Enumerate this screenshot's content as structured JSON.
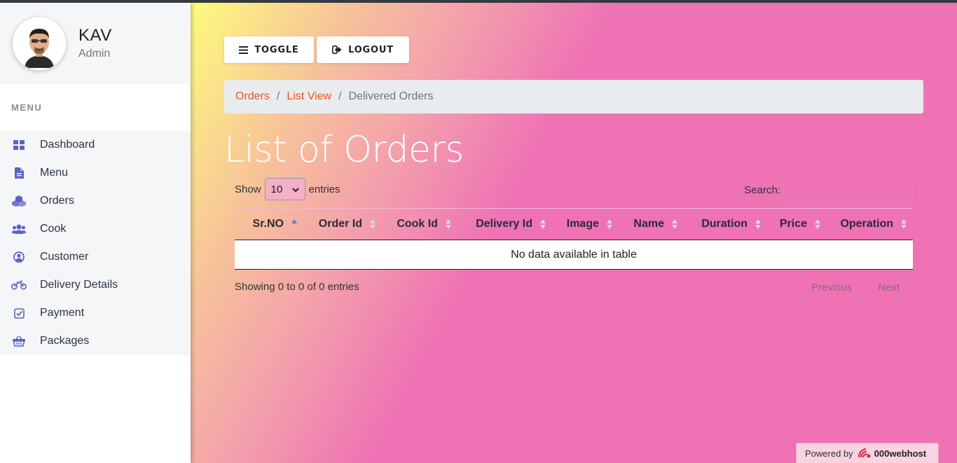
{
  "profile": {
    "name": "KAV",
    "role": "Admin"
  },
  "sidebar": {
    "menu_heading": "MENU",
    "items": [
      {
        "label": "Dashboard",
        "icon": "dashboard-grid-icon"
      },
      {
        "label": "Menu",
        "icon": "document-icon"
      },
      {
        "label": "Orders",
        "icon": "boxes-icon"
      },
      {
        "label": "Cook",
        "icon": "users-icon"
      },
      {
        "label": "Customer",
        "icon": "user-circle-icon"
      },
      {
        "label": "Delivery Details",
        "icon": "motorcycle-icon"
      },
      {
        "label": "Payment",
        "icon": "check-square-icon"
      },
      {
        "label": "Packages",
        "icon": "basket-icon"
      }
    ],
    "icon_color": "#5a63c4"
  },
  "toolbar": {
    "toggle_label": "TOGGLE",
    "logout_label": "LOGOUT"
  },
  "breadcrumb": {
    "items": [
      "Orders",
      "List View"
    ],
    "current": "Delivered Orders",
    "separator": "/"
  },
  "page_title": "List of Orders",
  "table_controls": {
    "show_label": "Show",
    "entries_label": "entries",
    "page_length": "10",
    "search_label": "Search:"
  },
  "table": {
    "columns": [
      "Sr.NO",
      "Order Id",
      "Cook Id",
      "Delivery Id",
      "Image",
      "Name",
      "Duration",
      "Price",
      "Operation"
    ],
    "empty_message": "No data available in table"
  },
  "pagination": {
    "info": "Showing 0 to 0 of 0 entries",
    "previous": "Previous",
    "next": "Next"
  },
  "footer": {
    "powered_by": "Powered by",
    "brand": "000webhost"
  },
  "colors": {
    "accent_link": "#e8561e",
    "background_pink": "#ef72b4",
    "background_yellow": "#fdfb7d"
  }
}
